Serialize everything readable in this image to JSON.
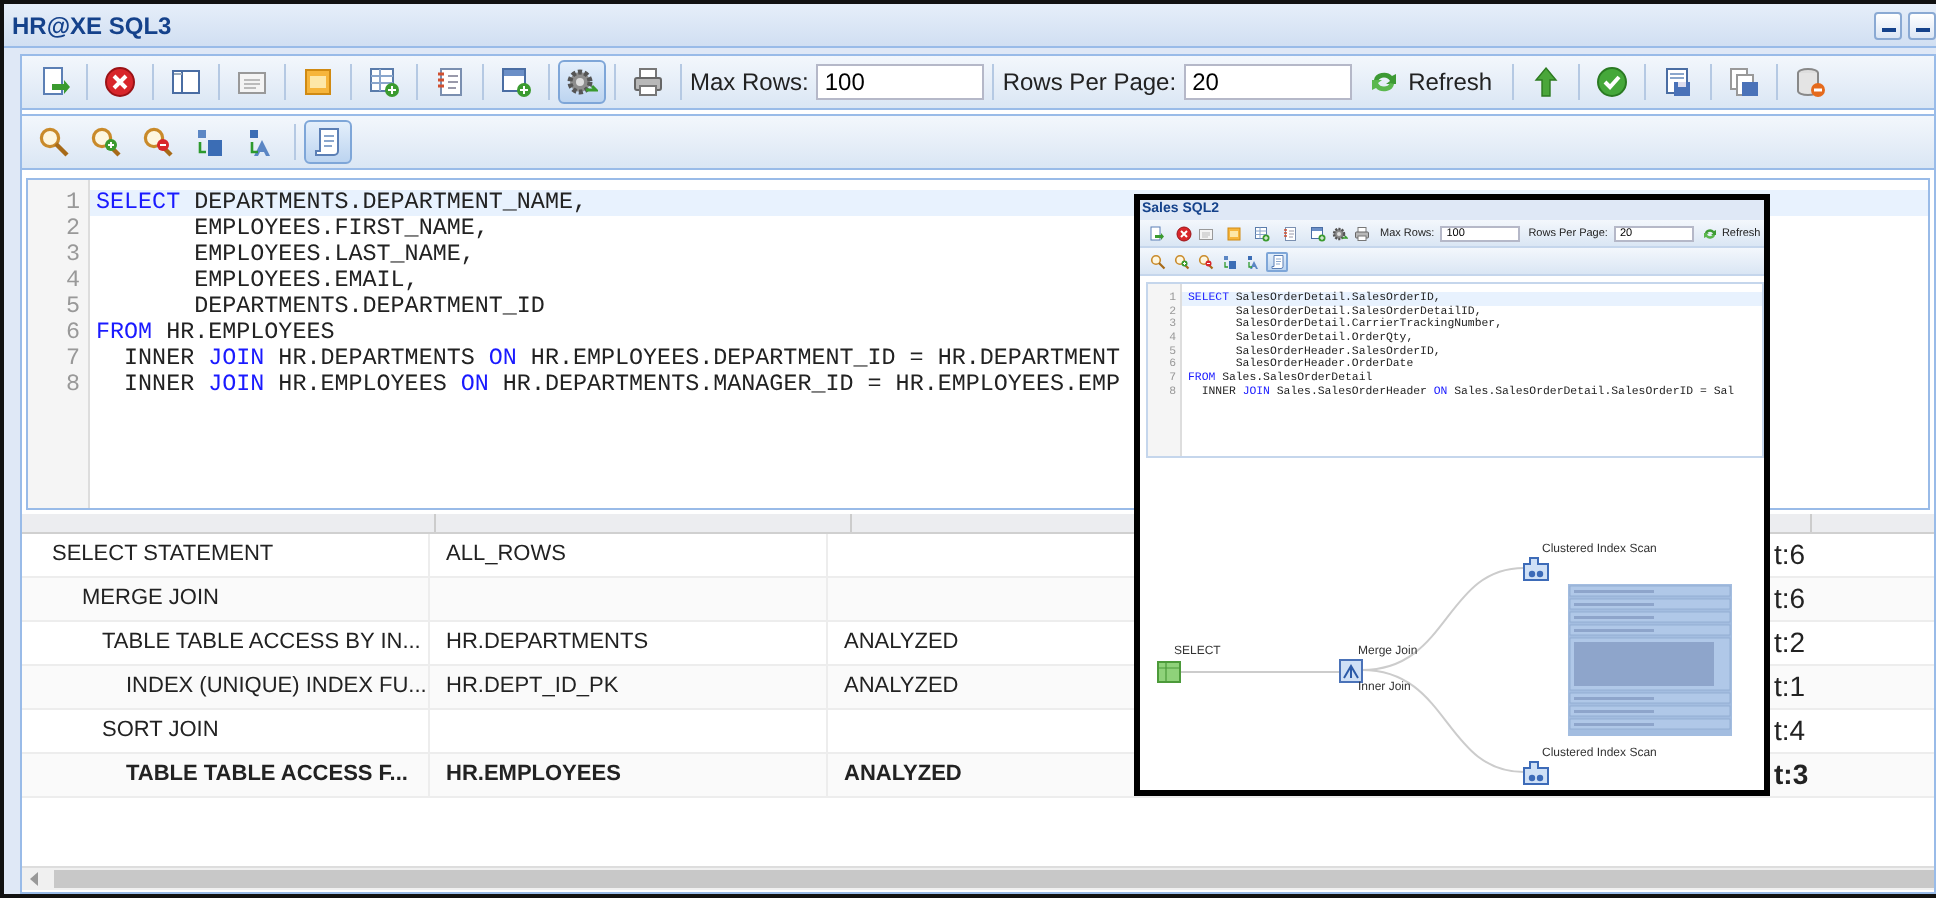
{
  "window": {
    "title": "HR@XE SQL3"
  },
  "toolbar": [
    {
      "kind": "export",
      "selected": false
    },
    {
      "kind": "separator"
    },
    {
      "kind": "stop",
      "selected": false
    },
    {
      "kind": "separator"
    },
    {
      "kind": "panel",
      "selected": false
    },
    {
      "kind": "separator"
    },
    {
      "kind": "document",
      "selected": false
    },
    {
      "kind": "separator"
    },
    {
      "kind": "note",
      "selected": false
    },
    {
      "kind": "separator"
    },
    {
      "kind": "tableplus",
      "selected": false
    },
    {
      "kind": "separator"
    },
    {
      "kind": "notebook",
      "selected": false
    },
    {
      "kind": "separator"
    },
    {
      "kind": "windowplus",
      "selected": false
    },
    {
      "kind": "separator"
    },
    {
      "kind": "gear",
      "selected": true
    },
    {
      "kind": "separator"
    },
    {
      "kind": "printer",
      "selected": false
    },
    {
      "kind": "separator"
    },
    {
      "kind": "field",
      "label": "Max Rows:",
      "value": "100"
    },
    {
      "kind": "separator"
    },
    {
      "kind": "field",
      "label": "Rows Per Page:",
      "value": "20"
    },
    {
      "kind": "refresh",
      "label": "Refresh"
    },
    {
      "kind": "separator"
    },
    {
      "kind": "up",
      "selected": false
    },
    {
      "kind": "separator"
    },
    {
      "kind": "check",
      "selected": false
    },
    {
      "kind": "separator"
    },
    {
      "kind": "docdisk",
      "selected": false
    },
    {
      "kind": "separator"
    },
    {
      "kind": "copydisk",
      "selected": false
    },
    {
      "kind": "separator"
    },
    {
      "kind": "dbminus",
      "selected": false
    }
  ],
  "toolbar_2": [
    {
      "kind": "search",
      "selected": false
    },
    {
      "kind": "zoomin",
      "selected": false
    },
    {
      "kind": "zoomout",
      "selected": false
    },
    {
      "kind": "sorta",
      "selected": false
    },
    {
      "kind": "sortb",
      "selected": false
    },
    {
      "kind": "separator"
    },
    {
      "kind": "page",
      "selected": true
    }
  ],
  "editor": {
    "lines": [
      {
        "number": "1",
        "current": true,
        "tokens": [
          {
            "kind": "keyword",
            "text": "SELECT"
          },
          {
            "kind": "plain",
            "text": " DEPARTMENTS.DEPARTMENT_NAME,"
          }
        ]
      },
      {
        "number": "2",
        "current": false,
        "tokens": [
          {
            "kind": "plain",
            "text": "       EMPLOYEES.FIRST_NAME,"
          }
        ]
      },
      {
        "number": "3",
        "current": false,
        "tokens": [
          {
            "kind": "plain",
            "text": "       EMPLOYEES.LAST_NAME,"
          }
        ]
      },
      {
        "number": "4",
        "current": false,
        "tokens": [
          {
            "kind": "plain",
            "text": "       EMPLOYEES.EMAIL,"
          }
        ]
      },
      {
        "number": "5",
        "current": false,
        "tokens": [
          {
            "kind": "plain",
            "text": "       DEPARTMENTS.DEPARTMENT_ID"
          }
        ]
      },
      {
        "number": "6",
        "current": false,
        "tokens": [
          {
            "kind": "keyword",
            "text": "FROM"
          },
          {
            "kind": "plain",
            "text": " HR.EMPLOYEES"
          }
        ]
      },
      {
        "number": "7",
        "current": false,
        "tokens": [
          {
            "kind": "plain",
            "text": "  INNER "
          },
          {
            "kind": "keyword",
            "text": "JOIN"
          },
          {
            "kind": "plain",
            "text": " HR.DEPARTMENTS "
          },
          {
            "kind": "keyword",
            "text": "ON"
          },
          {
            "kind": "plain",
            "text": " HR.EMPLOYEES.DEPARTMENT_ID = HR.DEPARTMENT"
          }
        ]
      },
      {
        "number": "8",
        "current": false,
        "tokens": [
          {
            "kind": "plain",
            "text": "  INNER "
          },
          {
            "kind": "keyword",
            "text": "JOIN"
          },
          {
            "kind": "plain",
            "text": " HR.EMPLOYEES "
          },
          {
            "kind": "keyword",
            "text": "ON"
          },
          {
            "kind": "plain",
            "text": " HR.DEPARTMENTS.MANAGER_ID = HR.EMPLOYEES.EMP"
          }
        ]
      }
    ]
  },
  "plan_grid": {
    "rows": [
      {
        "column_1": "SELECT STATEMENT",
        "column_2": "ALL_ROWS",
        "column_4": "t:6",
        "bold": false,
        "children": [
          {
            "column_1": "MERGE JOIN",
            "column_4": "t:6",
            "bold": false,
            "children": [
              {
                "column_1": "TABLE TABLE ACCESS BY IN...",
                "column_2": "HR.DEPARTMENTS",
                "column_3": "ANALYZED",
                "column_4": "t:2",
                "bold": false,
                "children": [
                  {
                    "column_1": "INDEX (UNIQUE) INDEX FU...",
                    "column_2": "HR.DEPT_ID_PK",
                    "column_3": "ANALYZED",
                    "column_4": "t:1",
                    "bold": false
                  }
                ]
              },
              {
                "column_1": "SORT JOIN",
                "column_4": "t:4",
                "bold": false,
                "children": [
                  {
                    "column_1": "TABLE TABLE ACCESS F...",
                    "column_2": "HR.EMPLOYEES",
                    "column_3": "ANALYZED",
                    "column_4": "t:3",
                    "bold": true
                  }
                ]
              }
            ]
          }
        ]
      }
    ]
  },
  "inset_window": {
    "title": "Sales SQL2",
    "toolbar": [
      {
        "kind": "export",
        "selected": false
      },
      {
        "kind": "separator"
      },
      {
        "kind": "stop",
        "selected": false
      },
      {
        "kind": "document",
        "selected": false
      },
      {
        "kind": "separator"
      },
      {
        "kind": "note",
        "selected": false
      },
      {
        "kind": "separator"
      },
      {
        "kind": "tableplus",
        "selected": false
      },
      {
        "kind": "separator"
      },
      {
        "kind": "notebook",
        "selected": false
      },
      {
        "kind": "separator"
      },
      {
        "kind": "windowplus",
        "selected": false
      },
      {
        "kind": "gear",
        "selected": false
      },
      {
        "kind": "printer",
        "selected": false
      },
      {
        "kind": "separator"
      },
      {
        "kind": "field",
        "label": "Max Rows:",
        "value": "100"
      },
      {
        "kind": "separator"
      },
      {
        "kind": "field",
        "label": "Rows Per Page:",
        "value": "20"
      },
      {
        "kind": "refresh",
        "label": "Refresh"
      }
    ],
    "toolbar_2": [
      {
        "kind": "search",
        "selected": false
      },
      {
        "kind": "zoomin",
        "selected": false
      },
      {
        "kind": "zoomout",
        "selected": false
      },
      {
        "kind": "sorta",
        "selected": false
      },
      {
        "kind": "sortb",
        "selected": false
      },
      {
        "kind": "page",
        "selected": true
      }
    ],
    "editor": {
      "lines": [
        {
          "number": "1",
          "current": true,
          "tokens": [
            {
              "kind": "keyword",
              "text": "SELECT"
            },
            {
              "kind": "plain",
              "text": " SalesOrderDetail.SalesOrderID,"
            }
          ]
        },
        {
          "number": "2",
          "current": false,
          "tokens": [
            {
              "kind": "plain",
              "text": "       SalesOrderDetail.SalesOrderDetailID,"
            }
          ]
        },
        {
          "number": "3",
          "current": false,
          "tokens": [
            {
              "kind": "plain",
              "text": "       SalesOrderDetail.CarrierTrackingNumber,"
            }
          ]
        },
        {
          "number": "4",
          "current": false,
          "tokens": [
            {
              "kind": "plain",
              "text": "       SalesOrderDetail.OrderQty,"
            }
          ]
        },
        {
          "number": "5",
          "current": false,
          "tokens": [
            {
              "kind": "plain",
              "text": "       SalesOrderHeader.SalesOrderID,"
            }
          ]
        },
        {
          "number": "6",
          "current": false,
          "tokens": [
            {
              "kind": "plain",
              "text": "       SalesOrderHeader.OrderDate"
            }
          ]
        },
        {
          "number": "7",
          "current": false,
          "tokens": [
            {
              "kind": "keyword",
              "text": "FROM"
            },
            {
              "kind": "plain",
              "text": " Sales.SalesOrderDetail"
            }
          ]
        },
        {
          "number": "8",
          "current": false,
          "tokens": [
            {
              "kind": "plain",
              "text": "  INNER "
            },
            {
              "kind": "keyword",
              "text": "JOIN"
            },
            {
              "kind": "plain",
              "text": " Sales.SalesOrderHeader "
            },
            {
              "kind": "keyword",
              "text": "ON"
            },
            {
              "kind": "plain",
              "text": " Sales.SalesOrderDetail.SalesOrderID = Sal"
            }
          ]
        }
      ]
    },
    "plan_diagram": {
      "nodes": [
        {
          "kind": "select",
          "label": "SELECT"
        },
        {
          "kind": "join",
          "label": "Merge Join",
          "sublabel": "Inner Join"
        },
        {
          "kind": "scan",
          "label": "Clustered Index Scan"
        },
        {
          "kind": "scan",
          "label": "Clustered Index Scan"
        }
      ]
    }
  }
}
